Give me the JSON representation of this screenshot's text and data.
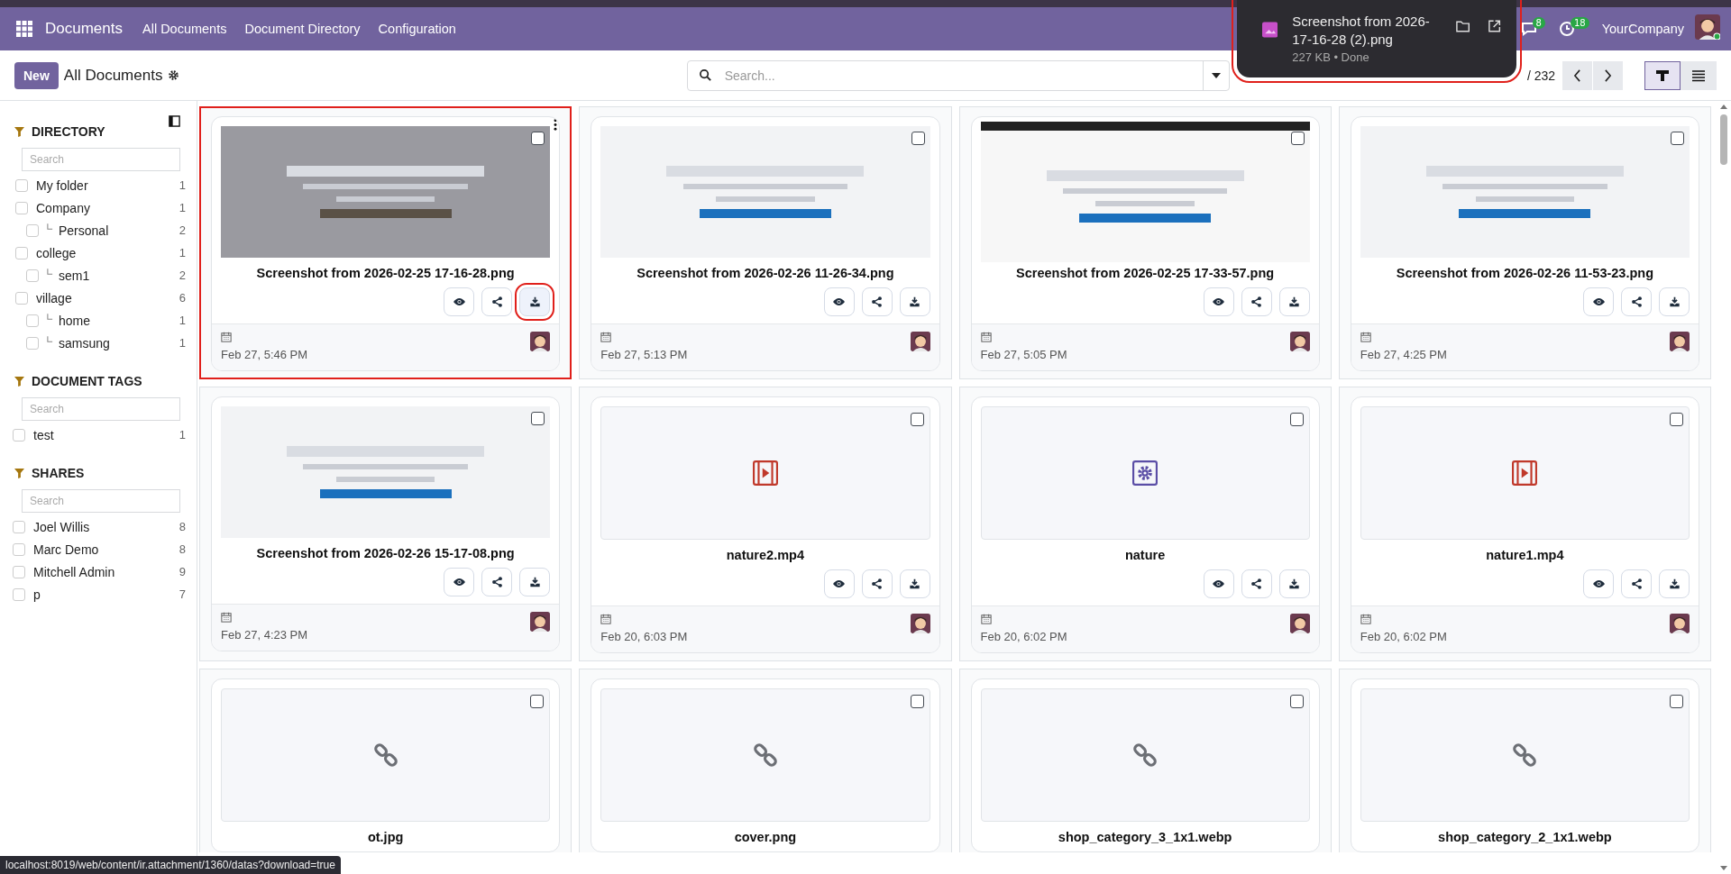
{
  "navbar": {
    "app_name": "Documents",
    "menu": [
      "All Documents",
      "Document Directory",
      "Configuration"
    ],
    "messages_badge": "8",
    "activities_badge": "18",
    "company": "YourCompany"
  },
  "control_panel": {
    "new_button": "New",
    "breadcrumb": "All Documents",
    "search_placeholder": "Search...",
    "pager": "/ 232",
    "views": [
      {
        "kind": "kanban",
        "selected": true
      },
      {
        "kind": "list",
        "selected": false
      }
    ]
  },
  "download_popup": {
    "file_name": "Screenshot from 2026-17-16-28 (2).png",
    "status": "227 KB • Done",
    "highlighted": true
  },
  "sidebar": {
    "sections": [
      {
        "title": "DIRECTORY",
        "search_placeholder": "Search",
        "items": [
          {
            "label": "My folder",
            "count": "1",
            "checked": false
          },
          {
            "label": "Company",
            "count": "1",
            "checked": false,
            "children": [
              {
                "label": "Personal",
                "count": "2",
                "checked": false
              }
            ]
          },
          {
            "label": "college",
            "count": "1",
            "checked": false,
            "children": [
              {
                "label": "sem1",
                "count": "2",
                "checked": false
              }
            ]
          },
          {
            "label": "village",
            "count": "6",
            "checked": false,
            "children": [
              {
                "label": "home",
                "count": "1",
                "checked": false
              },
              {
                "label": "samsung",
                "count": "1",
                "checked": false
              }
            ]
          }
        ]
      },
      {
        "title": "DOCUMENT TAGS",
        "search_placeholder": "Search",
        "items": [
          {
            "label": "test",
            "count": "1",
            "checked": false
          }
        ]
      },
      {
        "title": "SHARES",
        "search_placeholder": "Search",
        "items": [
          {
            "label": "Joel Willis",
            "count": "8",
            "checked": false
          },
          {
            "label": "Marc Demo",
            "count": "8",
            "checked": false
          },
          {
            "label": "Mitchell Admin",
            "count": "9",
            "checked": false
          },
          {
            "label": "p",
            "count": "7",
            "checked": false
          }
        ]
      }
    ]
  },
  "cards": [
    {
      "kind": "image",
      "name": "Screenshot from 2026-02-25 17-16-28.png",
      "date": "Feb 27, 5:46 PM",
      "selected": false,
      "highlighted": true
    },
    {
      "kind": "image",
      "name": "Screenshot from 2026-02-26 11-26-34.png",
      "date": "Feb 27, 5:13 PM",
      "selected": false,
      "highlighted": false
    },
    {
      "kind": "image",
      "name": "Screenshot from 2026-02-25 17-33-57.png",
      "date": "Feb 27, 5:05 PM",
      "selected": false,
      "highlighted": false
    },
    {
      "kind": "image",
      "name": "Screenshot from 2026-02-26 11-53-23.png",
      "date": "Feb 27, 4:25 PM",
      "selected": false,
      "highlighted": false
    },
    {
      "kind": "image",
      "name": "Screenshot from 2026-02-26 15-17-08.png",
      "date": "Feb 27, 4:23 PM",
      "selected": false,
      "highlighted": false
    },
    {
      "kind": "video",
      "name": "nature2.mp4",
      "date": "Feb 20, 6:03 PM",
      "selected": false,
      "highlighted": false
    },
    {
      "kind": "gear",
      "name": "nature",
      "date": "Feb 20, 6:02 PM",
      "selected": false,
      "highlighted": false
    },
    {
      "kind": "video",
      "name": "nature1.mp4",
      "date": "Feb 20, 6:02 PM",
      "selected": false,
      "highlighted": false
    },
    {
      "kind": "link",
      "name": "ot.jpg",
      "selected": false,
      "highlighted": false
    },
    {
      "kind": "link",
      "name": "cover.png",
      "selected": false,
      "highlighted": false
    },
    {
      "kind": "link",
      "name": "shop_category_3_1x1.webp",
      "selected": false,
      "highlighted": false
    },
    {
      "kind": "link",
      "name": "shop_category_2_1x1.webp",
      "selected": false,
      "highlighted": false
    }
  ],
  "status_url": "localhost:8019/web/content/ir.attachment/1360/datas?download=true"
}
